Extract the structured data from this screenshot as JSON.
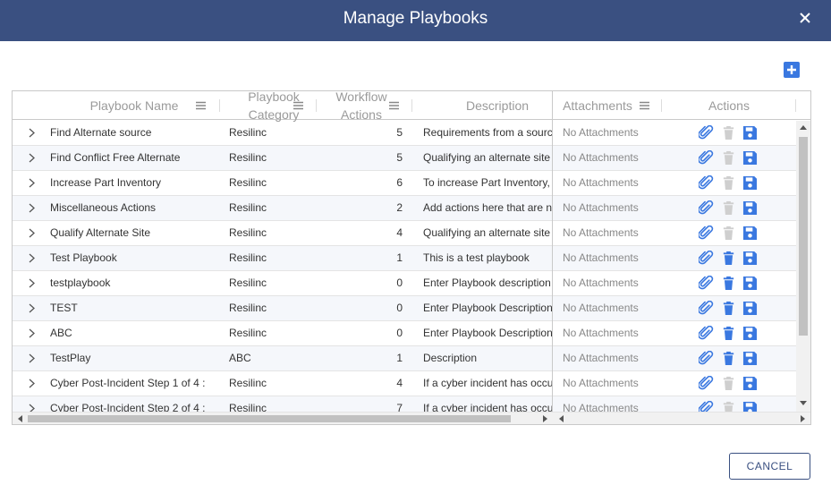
{
  "dialog": {
    "title": "Manage Playbooks",
    "cancel_label": "CANCEL"
  },
  "columns": {
    "name": "Playbook Name",
    "category_l1": "Playbook",
    "category_l2": "Category",
    "workflow_l1": "Workflow",
    "workflow_l2": "Actions",
    "description": "Description",
    "attachments": "Attachments",
    "actions": "Actions"
  },
  "colors": {
    "header_bg": "#3a5081",
    "action_blue": "#3a78e0",
    "disabled_gray": "#cfcfcf",
    "alt_row": "#f5f7fb"
  },
  "rows": [
    {
      "name": "Find Alternate source",
      "category": "Resilinc",
      "actions": "5",
      "description": "Requirements from a source",
      "attachments": "No Attachments",
      "delete_enabled": false
    },
    {
      "name": "Find Conflict Free Alternate",
      "category": "Resilinc",
      "actions": "5",
      "description": "Qualifying an alternate site is",
      "attachments": "No Attachments",
      "delete_enabled": false
    },
    {
      "name": "Increase Part Inventory",
      "category": "Resilinc",
      "actions": "6",
      "description": "To increase Part Inventory, the",
      "attachments": "No Attachments",
      "delete_enabled": false
    },
    {
      "name": "Miscellaneous Actions",
      "category": "Resilinc",
      "actions": "2",
      "description": "Add actions here that are not",
      "attachments": "No Attachments",
      "delete_enabled": false
    },
    {
      "name": "Qualify Alternate Site",
      "category": "Resilinc",
      "actions": "4",
      "description": "Qualifying an alternate site is",
      "attachments": "No Attachments",
      "delete_enabled": false
    },
    {
      "name": "Test Playbook",
      "category": "Resilinc",
      "actions": "1",
      "description": "This is a test playbook",
      "attachments": "No Attachments",
      "delete_enabled": true
    },
    {
      "name": "testplaybook",
      "category": "Resilinc",
      "actions": "0",
      "description": "Enter Playbook description",
      "attachments": "No Attachments",
      "delete_enabled": true
    },
    {
      "name": "TEST",
      "category": "Resilinc",
      "actions": "0",
      "description": "Enter Playbook Description",
      "attachments": "No Attachments",
      "delete_enabled": true
    },
    {
      "name": "ABC",
      "category": "Resilinc",
      "actions": "0",
      "description": "Enter Playbook Description",
      "attachments": "No Attachments",
      "delete_enabled": true
    },
    {
      "name": "TestPlay",
      "category": "ABC",
      "actions": "1",
      "description": "Description",
      "attachments": "No Attachments",
      "delete_enabled": true
    },
    {
      "name": "Cyber Post-Incident Step 1 of 4 :",
      "category": "Resilinc",
      "actions": "4",
      "description": "If a cyber incident has occurred",
      "attachments": "No Attachments",
      "delete_enabled": false
    },
    {
      "name": "Cyber Post-Incident Step 2 of 4 :",
      "category": "Resilinc",
      "actions": "7",
      "description": "If a cyber incident has occurred",
      "attachments": "No Attachments",
      "delete_enabled": false
    }
  ]
}
